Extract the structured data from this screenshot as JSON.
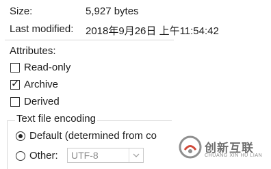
{
  "properties": {
    "size_label": "Size:",
    "size_value": "5,927 bytes",
    "modified_label": "Last modified:",
    "modified_value": "2018年9月26日 上午11:54:42"
  },
  "attributes": {
    "heading": "Attributes:",
    "read_only": {
      "label": "Read-only",
      "checked": false
    },
    "archive": {
      "label": "Archive",
      "checked": true
    },
    "derived": {
      "label": "Derived",
      "checked": false
    }
  },
  "encoding": {
    "group_title": "Text file encoding",
    "default_label": "Default (determined from co",
    "default_selected": true,
    "other_label": "Other:",
    "other_selected": false,
    "other_value": "UTF-8"
  },
  "watermark": {
    "name": "创新互联",
    "subtitle": "CHUANG XIN HU LIAN"
  },
  "icons": {
    "check": "checkmark-icon",
    "dropdown": "chevron-down-icon",
    "logo": "brand-logo-icon"
  }
}
